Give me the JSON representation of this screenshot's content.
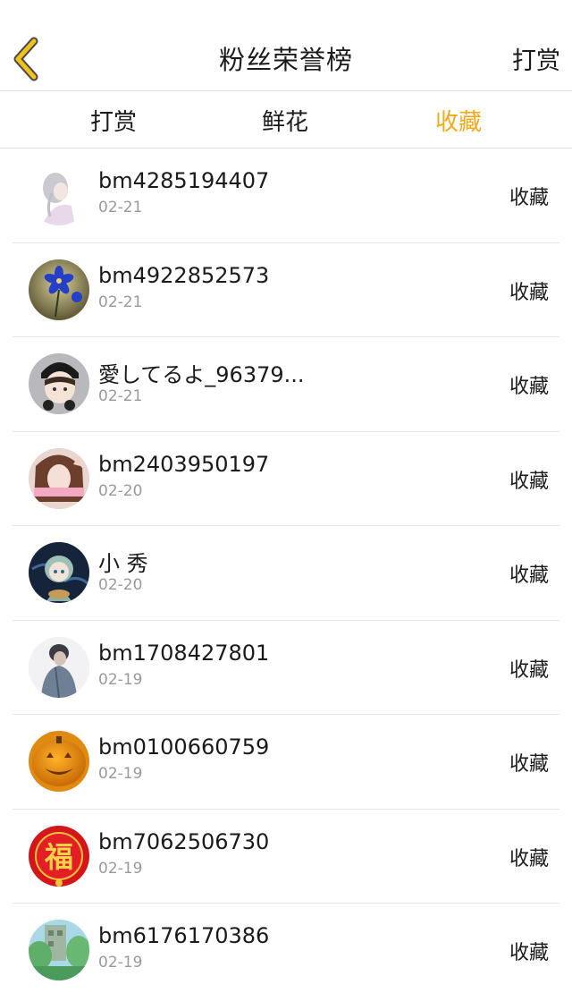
{
  "header": {
    "back_icon": "chevron-left-icon",
    "back_color": "#f2c21b",
    "title": "粉丝荣誉榜",
    "right_label": "打赏"
  },
  "tabs": [
    {
      "label": "打赏",
      "active": false
    },
    {
      "label": "鲜花",
      "active": false
    },
    {
      "label": "收藏",
      "active": true
    }
  ],
  "accent_color": "#f2a91b",
  "fans": [
    {
      "name": "bm4285194407",
      "date": "02-21",
      "action": "收藏"
    },
    {
      "name": "bm4922852573",
      "date": "02-21",
      "action": "收藏"
    },
    {
      "name": "愛してるよ_96379...",
      "date": "02-21",
      "action": "收藏"
    },
    {
      "name": "bm2403950197",
      "date": "02-20",
      "action": "收藏"
    },
    {
      "name": "小 秀",
      "date": "02-20",
      "action": "收藏"
    },
    {
      "name": "bm1708427801",
      "date": "02-19",
      "action": "收藏"
    },
    {
      "name": "bm0100660759",
      "date": "02-19",
      "action": "收藏"
    },
    {
      "name": "bm7062506730",
      "date": "02-19",
      "action": "收藏"
    },
    {
      "name": "bm6176170386",
      "date": "02-19",
      "action": "收藏"
    }
  ]
}
